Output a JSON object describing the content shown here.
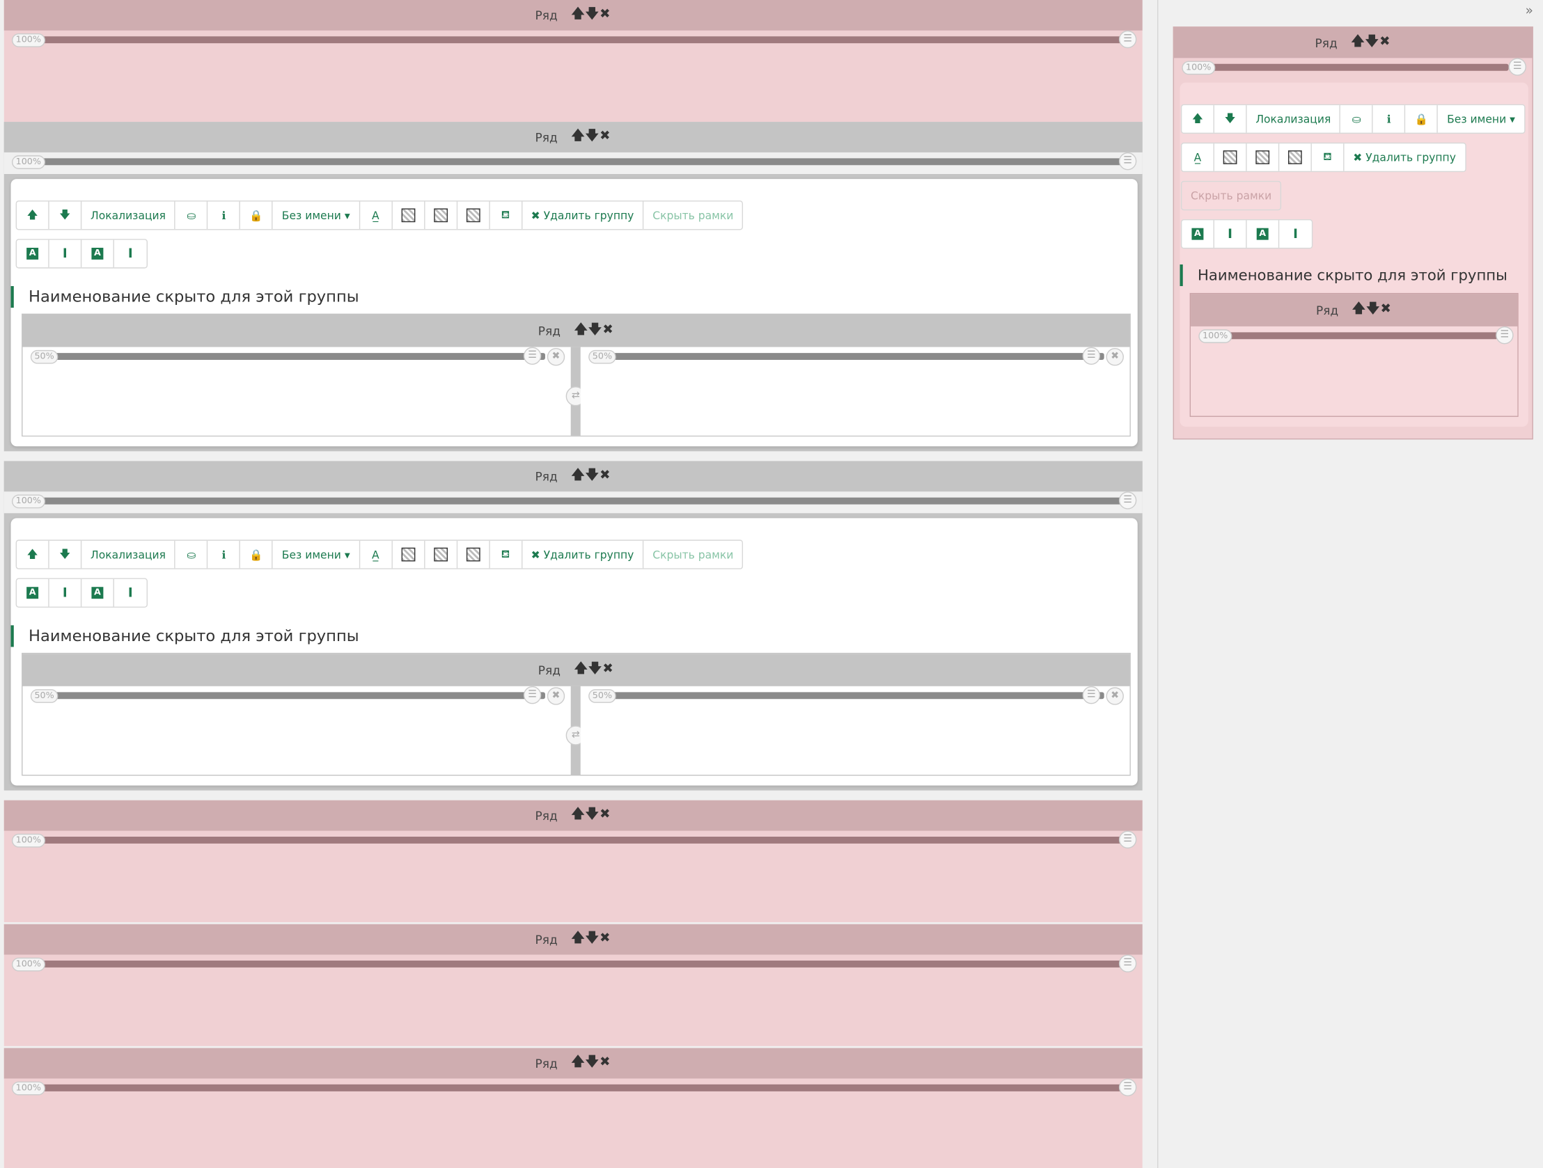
{
  "row_label": "Ряд",
  "row_controls": "🡅🡇✖",
  "pct_100": "100%",
  "pct_50": "50%",
  "toolbar": {
    "up": "🡅",
    "down": "🡇",
    "localization": "Локализация",
    "binoculars": "binoculars-icon",
    "info": "ℹ",
    "lock": "lock-icon",
    "name_dropdown": "Без имени ▾",
    "font_color": "A̲",
    "paint": "paint-bucket-icon",
    "delete_group": "✖ Удалить группу",
    "hide_frames": "Скрыть рамки",
    "text_a": "A",
    "text_i": "I"
  },
  "group_title": "Наименование скрыто для этой группы",
  "sidebar": {
    "collapse": "»"
  },
  "colors": {
    "accent": "#1c7a4f",
    "pink_row": "#cfadb0",
    "pink_body": "#f0d0d3",
    "gray_row": "#c4c4c4"
  }
}
